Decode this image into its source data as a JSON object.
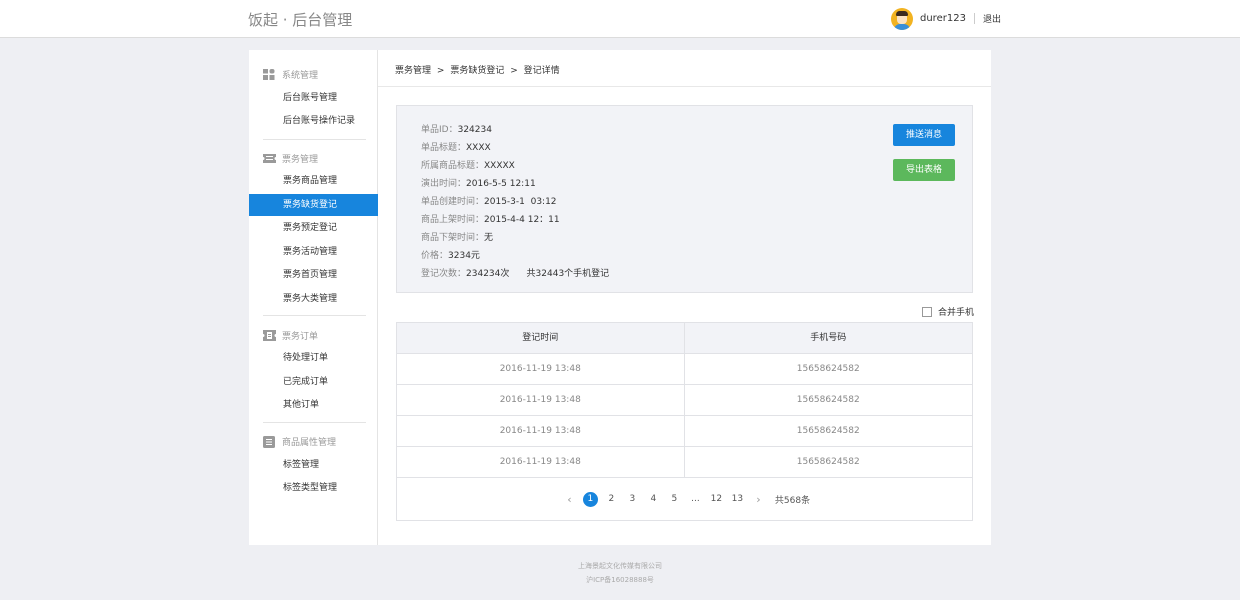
{
  "header": {
    "brand": "饭起 · 后台管理",
    "username": "durer123",
    "logout": "退出"
  },
  "sidebar": {
    "groups": [
      {
        "title": "系统管理",
        "icon": "grid-icon",
        "items": [
          "后台账号管理",
          "后台账号操作记录"
        ]
      },
      {
        "title": "票务管理",
        "icon": "ticket-icon",
        "items": [
          "票务商品管理",
          "票务缺货登记",
          "票务预定登记",
          "票务活动管理",
          "票务首页管理",
          "票务大类管理"
        ]
      },
      {
        "title": "票务订单",
        "icon": "order-ticket-icon",
        "items": [
          "待处理订单",
          "已完成订单",
          "其他订单"
        ]
      },
      {
        "title": "商品属性管理",
        "icon": "list-icon",
        "items": [
          "标签管理",
          "标签类型管理"
        ]
      }
    ],
    "active": "票务缺货登记"
  },
  "breadcrumb": [
    "票务管理",
    ">",
    "票务缺货登记",
    ">",
    "登记详情"
  ],
  "info": {
    "rows": [
      {
        "label": "单品ID：",
        "value": "324234"
      },
      {
        "label": "单品标题：",
        "value": "XXXX"
      },
      {
        "label": "所属商品标题：",
        "value": "XXXXX"
      },
      {
        "label": "演出时间：",
        "value": "2016-5-5 12:11"
      },
      {
        "label": "单品创建时间：",
        "value": "2015-3-1  03:12"
      },
      {
        "label": "商品上架时间：",
        "value": "2015-4-4 12：11"
      },
      {
        "label": "商品下架时间：",
        "value": "无"
      },
      {
        "label": "价格：",
        "value": "3234元"
      },
      {
        "label": "登记次数：",
        "value": "234234次      共32443个手机登记"
      }
    ],
    "push_button": "推送消息",
    "export_button": "导出表格"
  },
  "merge_label": "合并手机",
  "table": {
    "headers": [
      "登记时间",
      "手机号码"
    ],
    "rows": [
      [
        "2016-11-19  13:48",
        "15658624582"
      ],
      [
        "2016-11-19  13:48",
        "15658624582"
      ],
      [
        "2016-11-19  13:48",
        "15658624582"
      ],
      [
        "2016-11-19  13:48",
        "15658624582"
      ]
    ]
  },
  "pagination": {
    "prev": "‹",
    "pages": [
      "1",
      "2",
      "3",
      "4",
      "5",
      "...",
      "12",
      "13"
    ],
    "current": "1",
    "next": "›",
    "total": "共568条"
  },
  "footer": {
    "company": "上海景起文化传媒有限公司",
    "icp": "沪ICP备16028888号"
  }
}
